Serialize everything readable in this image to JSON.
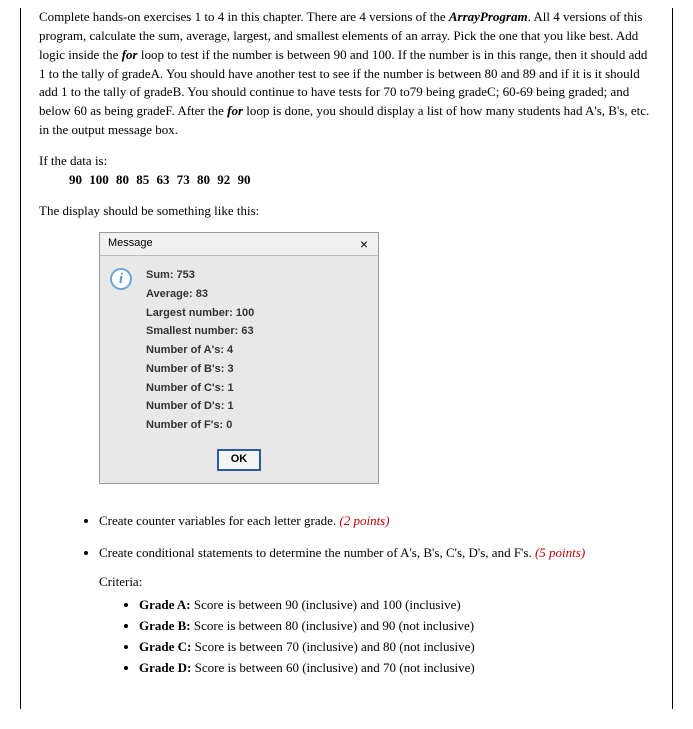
{
  "intro": {
    "p1a": "Complete hands-on exercises 1 to 4 in this chapter. There are 4 versions of the ",
    "p1b": "ArrayProgram",
    "p1c": ". All 4 versions of this program, calculate the sum, average, largest, and smallest elements of an array. Pick the one that you like best. Add logic inside the ",
    "p1d": "for",
    "p1e": " loop to test if the number is between 90 and 100. If the number is in this range, then it should add 1 to the tally of gradeA. You should have another test to see if the number is between 80 and 89 and if it is it should add 1 to the tally of gradeB. You should continue to have tests for 70 to79 being gradeC; 60-69 being graded; and below 60 as being gradeF. After the ",
    "p1f": "for",
    "p1g": " loop is done, you should display a list of how many students had A's, B's, etc. in the output message box."
  },
  "data_block": {
    "label": "If the data is:",
    "values": "90  100  80  85  63  73  80  92  90"
  },
  "display_intro": "The display should be something like this:",
  "message": {
    "title": "Message",
    "close": "×",
    "info_glyph": "i",
    "lines": {
      "sum": "Sum: 753",
      "avg": "Average: 83",
      "largest": "Largest number: 100",
      "smallest": "Smallest number: 63",
      "na": "Number of A's: 4",
      "nb": "Number of B's: 3",
      "nc": "Number of C's: 1",
      "nd": "Number of D's: 1",
      "nf": "Number of F's: 0"
    },
    "ok": "OK"
  },
  "bullets": {
    "b1_text": "Create counter variables for each letter grade. ",
    "b1_pts": "(2 points)",
    "b2_text": "Create conditional statements to determine the number of A's, B's, C's, D's, and F's. ",
    "b2_pts": "(5 points)",
    "criteria_label": "Criteria:",
    "criteria": {
      "a": {
        "bold": "Grade A:",
        "rest": " Score is between 90 (inclusive) and 100 (inclusive)"
      },
      "b": {
        "bold": "Grade B:",
        "rest": " Score is between 80 (inclusive) and 90 (not inclusive)"
      },
      "c": {
        "bold": "Grade C:",
        "rest": " Score is between 70 (inclusive) and 80 (not inclusive)"
      },
      "d": {
        "bold": "Grade D:",
        "rest": " Score is between 60 (inclusive) and 70 (not inclusive)"
      }
    }
  }
}
